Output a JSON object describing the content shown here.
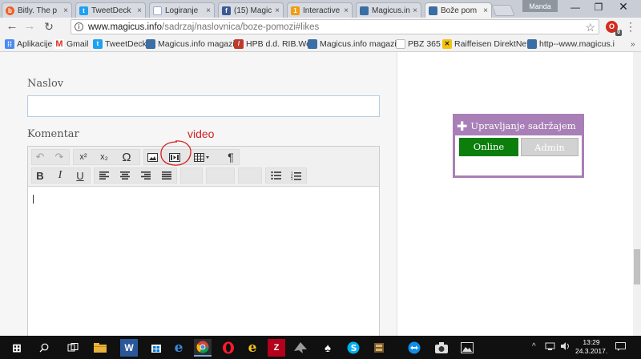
{
  "browser": {
    "tabs": [
      {
        "title": "Bitly. The p",
        "icon": "bitly-icon",
        "color": "#ee6123"
      },
      {
        "title": "TweetDeck",
        "icon": "tweetdeck-icon",
        "color": "#1da1f2"
      },
      {
        "title": "Logiranje",
        "icon": "page-icon",
        "color": "#9aa9c9"
      },
      {
        "title": "(15) Magic",
        "icon": "facebook-icon",
        "color": "#3b5998"
      },
      {
        "title": "Interactive",
        "icon": "interactive-icon",
        "color": "#f39c12"
      },
      {
        "title": "Magicus.in",
        "icon": "magicus-icon",
        "color": "#3a6ea5"
      },
      {
        "title": "Bože pom",
        "icon": "magicus-icon",
        "color": "#3a6ea5"
      }
    ],
    "close_glyph": "×",
    "profile_name": "Manda",
    "window_controls": {
      "minimize": "—",
      "maximize": "❐",
      "close": "✕"
    },
    "url_host": "www.magicus.info",
    "url_path": "/sadrzaj/naslovnica/boze-pomozi#likes",
    "extension_badge": "0",
    "bookmarks": [
      {
        "label": "Aplikacije",
        "icon": "apps-grid-icon",
        "color": "#4a8af4"
      },
      {
        "label": "Gmail",
        "icon": "gmail-icon",
        "color": "#d93025"
      },
      {
        "label": "TweetDeck",
        "icon": "tweetdeck-icon",
        "color": "#1da1f2"
      },
      {
        "label": "Magicus.info magazin",
        "icon": "magicus-icon",
        "color": "#3a6ea5"
      },
      {
        "label": "HPB d.d. RIB.Web",
        "icon": "hpb-icon",
        "color": "#c0392b"
      },
      {
        "label": "Magicus.info magazin",
        "icon": "magicus-icon",
        "color": "#3a6ea5"
      },
      {
        "label": "PBZ 365",
        "icon": "page-icon",
        "color": "#c9c9c9"
      },
      {
        "label": "Raiffeisen DirektNet",
        "icon": "raiffeisen-icon",
        "color": "#f1c40f"
      },
      {
        "label": "http--www.magicus.i",
        "icon": "magicus-icon",
        "color": "#3a6ea5"
      }
    ]
  },
  "form": {
    "title_label": "Naslov",
    "title_value": "",
    "comment_label": "Komentar",
    "editor_content": ""
  },
  "editor_toolbar": {
    "row1": [
      {
        "name": "undo",
        "glyph": "↶",
        "enabled": false
      },
      {
        "name": "redo",
        "glyph": "↷",
        "enabled": false
      },
      {
        "name": "superscript",
        "glyph": "x²",
        "enabled": true
      },
      {
        "name": "subscript",
        "glyph": "x₂",
        "enabled": true
      },
      {
        "name": "special-character",
        "glyph": "Ω",
        "enabled": true
      },
      {
        "name": "image",
        "glyph": "▨",
        "enabled": true
      },
      {
        "name": "video",
        "glyph": "▶",
        "enabled": true
      },
      {
        "name": "table",
        "glyph": "▦▾",
        "enabled": true
      },
      {
        "name": "paragraph-mark",
        "glyph": "¶",
        "enabled": true
      }
    ],
    "row2": [
      {
        "name": "bold",
        "glyph": "B"
      },
      {
        "name": "italic",
        "glyph": "I"
      },
      {
        "name": "underline",
        "glyph": "U"
      },
      {
        "name": "align-left",
        "glyph": "≡"
      },
      {
        "name": "align-center",
        "glyph": "≡"
      },
      {
        "name": "align-right",
        "glyph": "≡"
      },
      {
        "name": "justify",
        "glyph": "≡"
      },
      {
        "name": "bullet-list",
        "glyph": "☰"
      },
      {
        "name": "numbered-list",
        "glyph": "☷"
      }
    ]
  },
  "annotation": {
    "text": "video",
    "color": "#d32020"
  },
  "widget": {
    "title": "Upravljanje sadržajem",
    "plus_glyph": "✚",
    "online_label": "Online",
    "admin_label": "Admin",
    "colors": {
      "frame": "#a97fb7",
      "online": "#0b7e0b",
      "admin": "#d2d2d2"
    }
  },
  "taskbar": {
    "time": "13:29",
    "date": "24.3.2017.",
    "apps": [
      {
        "name": "start-icon",
        "glyph": "⊞"
      },
      {
        "name": "search-icon",
        "glyph": "⚲"
      },
      {
        "name": "task-view-icon",
        "glyph": "▭"
      },
      {
        "name": "file-explorer-icon",
        "glyph": "▬"
      },
      {
        "name": "word-icon",
        "glyph": "W"
      },
      {
        "name": "store-icon",
        "glyph": "▢"
      },
      {
        "name": "edge-icon",
        "glyph": "e"
      },
      {
        "name": "chrome-icon",
        "glyph": "◉"
      },
      {
        "name": "opera-icon",
        "glyph": "O"
      },
      {
        "name": "ie-icon",
        "glyph": "e"
      },
      {
        "name": "filezilla-icon",
        "glyph": "Z"
      },
      {
        "name": "inkscape-icon",
        "glyph": "◐"
      },
      {
        "name": "solitaire-icon",
        "glyph": "♠"
      },
      {
        "name": "skype-icon",
        "glyph": "S"
      },
      {
        "name": "archive-icon",
        "glyph": "▤"
      },
      {
        "name": "teamviewer-icon",
        "glyph": "⇄"
      },
      {
        "name": "camera-icon",
        "glyph": "◙"
      },
      {
        "name": "photos-icon",
        "glyph": "▲"
      }
    ]
  }
}
